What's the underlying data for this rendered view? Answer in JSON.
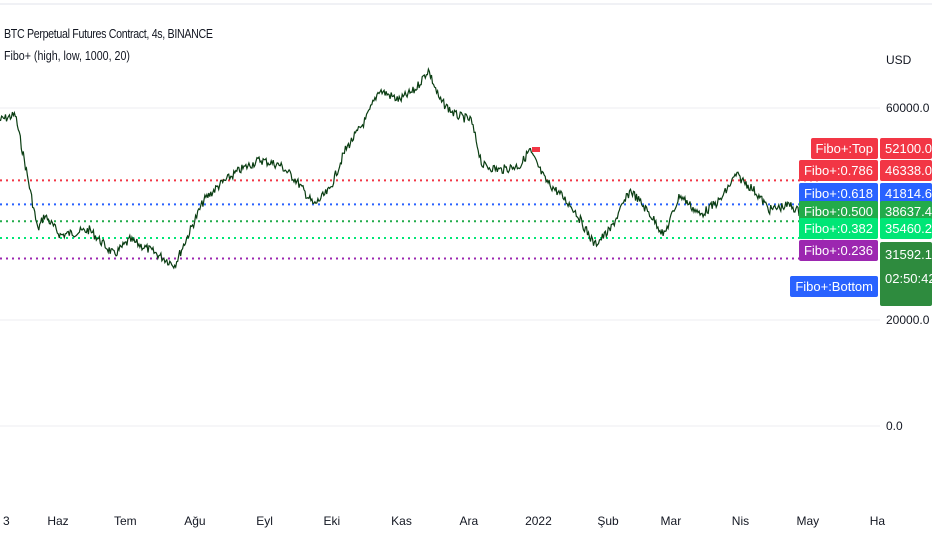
{
  "header": {
    "title": "BTC Perpetual Futures Contract, 4s, BINANCE",
    "indicator": "Fibo+ (high, low, 1000, 20)"
  },
  "chart_data": {
    "type": "line",
    "currency": "USD",
    "ylim": [
      -5000,
      80000
    ],
    "y_ticks": [
      {
        "v": 60000,
        "label": "60000.0"
      },
      {
        "v": 20000,
        "label": "20000.0"
      },
      {
        "v": 0,
        "label": "0.0"
      }
    ],
    "x_ticks": [
      {
        "d": "2021-05-01",
        "label": "3"
      },
      {
        "d": "2021-06-01",
        "label": "Haz"
      },
      {
        "d": "2021-07-01",
        "label": "Tem"
      },
      {
        "d": "2021-08-01",
        "label": "Ağu"
      },
      {
        "d": "2021-09-01",
        "label": "Eyl"
      },
      {
        "d": "2021-10-01",
        "label": "Eki"
      },
      {
        "d": "2021-11-01",
        "label": "Kas"
      },
      {
        "d": "2021-12-01",
        "label": "Ara"
      },
      {
        "d": "2022-01-01",
        "label": "2022"
      },
      {
        "d": "2022-02-01",
        "label": "Şub"
      },
      {
        "d": "2022-03-01",
        "label": "Mar"
      },
      {
        "d": "2022-04-01",
        "label": "Nis"
      },
      {
        "d": "2022-05-01",
        "label": "May"
      },
      {
        "d": "2022-06-01",
        "label": "Ha"
      }
    ],
    "series": [
      {
        "values": [
          [
            "2021-05-06",
            57700
          ],
          [
            "2021-05-13",
            58700
          ],
          [
            "2021-05-17",
            50200
          ],
          [
            "2021-05-23",
            37000
          ],
          [
            "2021-05-26",
            39800
          ],
          [
            "2021-06-02",
            36000
          ],
          [
            "2021-06-15",
            37000
          ],
          [
            "2021-06-26",
            32300
          ],
          [
            "2021-07-03",
            35100
          ],
          [
            "2021-07-12",
            33200
          ],
          [
            "2021-07-23",
            30400
          ],
          [
            "2021-07-30",
            37000
          ],
          [
            "2021-08-05",
            42600
          ],
          [
            "2021-08-12",
            45500
          ],
          [
            "2021-08-21",
            48300
          ],
          [
            "2021-08-30",
            50200
          ],
          [
            "2021-09-08",
            49200
          ],
          [
            "2021-09-15",
            46400
          ],
          [
            "2021-09-23",
            41700
          ],
          [
            "2021-09-30",
            44500
          ],
          [
            "2021-10-07",
            52100
          ],
          [
            "2021-10-16",
            57700
          ],
          [
            "2021-10-22",
            63400
          ],
          [
            "2021-10-31",
            61500
          ],
          [
            "2021-11-07",
            63400
          ],
          [
            "2021-11-13",
            67200
          ],
          [
            "2021-11-18",
            61500
          ],
          [
            "2021-11-25",
            58700
          ],
          [
            "2021-12-02",
            57700
          ],
          [
            "2021-12-07",
            49200
          ],
          [
            "2021-12-15",
            48300
          ],
          [
            "2021-12-24",
            49200
          ],
          [
            "2021-12-28",
            52100
          ],
          [
            "2022-01-04",
            46400
          ],
          [
            "2022-01-11",
            43600
          ],
          [
            "2022-01-17",
            40800
          ],
          [
            "2022-01-26",
            34200
          ],
          [
            "2022-02-02",
            37000
          ],
          [
            "2022-02-11",
            44500
          ],
          [
            "2022-02-20",
            39800
          ],
          [
            "2022-02-26",
            36000
          ],
          [
            "2022-03-05",
            43600
          ],
          [
            "2022-03-14",
            39800
          ],
          [
            "2022-03-23",
            42600
          ],
          [
            "2022-03-30",
            47400
          ],
          [
            "2022-04-07",
            44500
          ],
          [
            "2022-04-14",
            40800
          ],
          [
            "2022-04-23",
            41700
          ],
          [
            "2022-05-02",
            38900
          ],
          [
            "2022-05-09",
            35100
          ]
        ]
      }
    ],
    "fibo_levels": [
      {
        "name": "Fibo+:Top",
        "value": 52100.0,
        "value_label": "52100.0",
        "color": "#f23645"
      },
      {
        "name": "Fibo+:0.786",
        "value": 46338.0,
        "value_label": "46338.0",
        "color": "#f23645"
      },
      {
        "name": "Fibo+:0.618",
        "value": 41814.6,
        "value_label": "41814.6",
        "color": "#2962ff"
      },
      {
        "name": "Fibo+:0.500",
        "value": 38637.4,
        "value_label": "38637.4",
        "color": "#22ab4a"
      },
      {
        "name": "Fibo+:0.382",
        "value": 35460.2,
        "value_label": "35460.2",
        "color": "#00e676"
      },
      {
        "name": "Fibo+:0.236",
        "value": 31592.1,
        "value_label": "31592.1",
        "color": "#9c27b0"
      },
      {
        "name": "Fibo+:Bottom",
        "value": 25174.8,
        "color": "#2962ff"
      }
    ],
    "last_price": {
      "value_label": "31592.1",
      "countdown": "02:50:42",
      "color": "#2e8b3e"
    }
  }
}
